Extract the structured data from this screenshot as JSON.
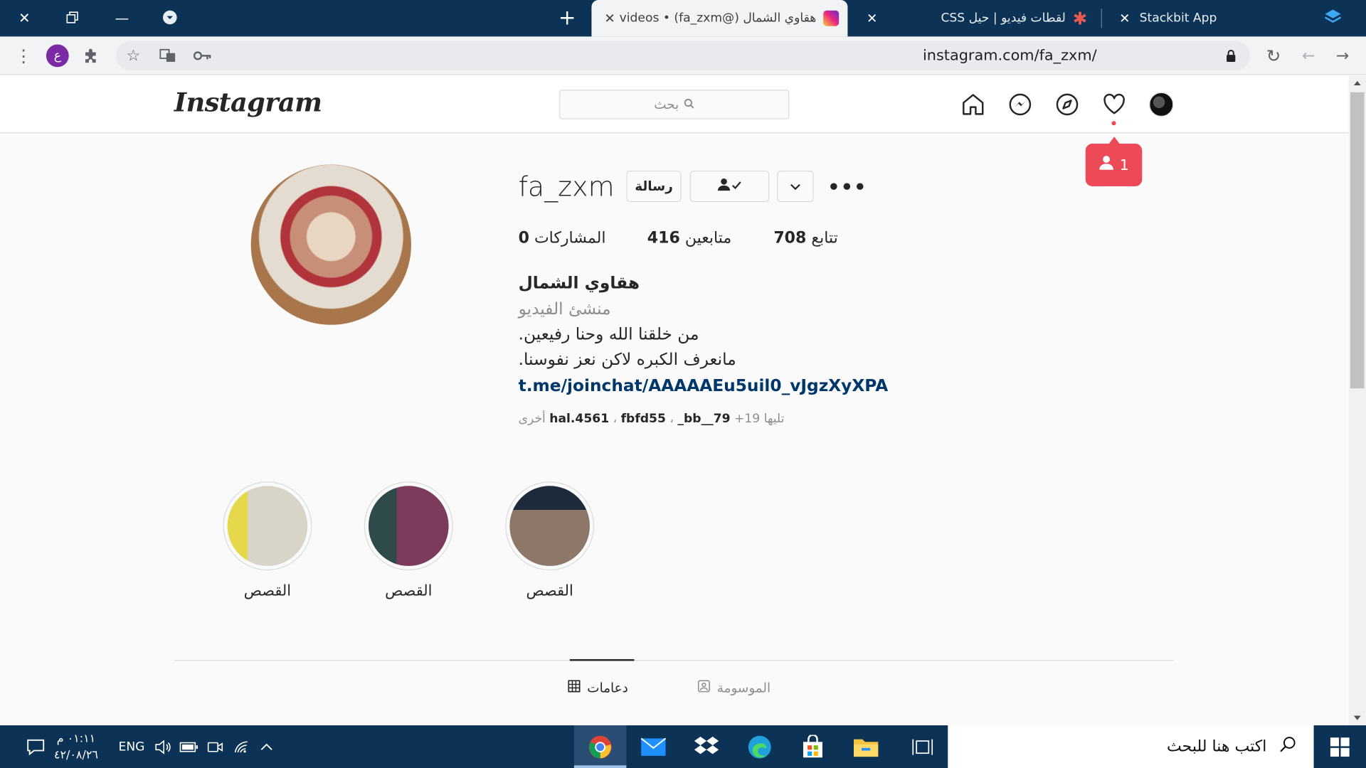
{
  "browser": {
    "tabs": [
      {
        "title": "Stackbit App",
        "favicon": "stackbit-icon",
        "active": false
      },
      {
        "title": "لقطات فيديو | حيل CSS",
        "favicon": "css-tricks-icon",
        "active": false
      },
      {
        "title": "هقاوي الشمال (@fa_zxm) • videos",
        "favicon": "instagram-icon",
        "active": true
      }
    ],
    "url": "instagram.com/fa_zxm/",
    "profile_initial": "ع"
  },
  "instagram": {
    "logo": "Instagram",
    "search_placeholder": "بحث",
    "notification_count": "1",
    "profile": {
      "username": "fa_zxm",
      "message_button": "رسالة",
      "stats": {
        "following": {
          "label": "تتابع",
          "count": "708"
        },
        "followers": {
          "label": "متابعين",
          "count": "416"
        },
        "posts": {
          "label": "المشاركات",
          "count": "0"
        }
      },
      "full_name": "هقاوي الشمال",
      "category": "منشئ الفيديو",
      "bio_line1": "من خلقنا الله وحنا رفيعين.",
      "bio_line2": "مانعرف الكبره لاكن نعز نفوسنا.",
      "bio_link": "t.me/joinchat/AAAAAEu5uil0_vJgzXyXPA",
      "followed_by": {
        "prefix": "تليها",
        "users": [
          "hal.4561",
          "fbfd55",
          "_bb__79"
        ],
        "separator": "،",
        "more": "+19 أخرى"
      }
    },
    "highlights": [
      {
        "label": "القصص"
      },
      {
        "label": "القصص"
      },
      {
        "label": "القصص"
      }
    ],
    "tabs": [
      {
        "label": "دعامات",
        "icon": "grid-icon",
        "active": true
      },
      {
        "label": "الموسومة",
        "icon": "tagged-icon",
        "active": false
      }
    ]
  },
  "taskbar": {
    "search_placeholder": "اكتب هنا للبحث",
    "language": "ENG",
    "time": "٠١:١١ م",
    "date": "٤٢/٠٨/٢٦"
  }
}
